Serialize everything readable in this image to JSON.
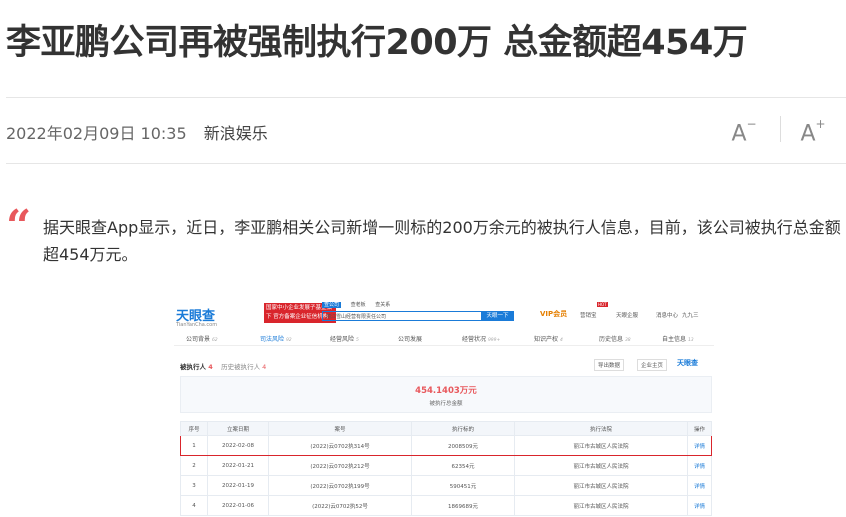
{
  "article": {
    "title": "李亚鹏公司再被强制执行200万 总金额超454万",
    "date": "2022年02月09日 10:35",
    "source": "新浪娱乐",
    "font_decrease": "A",
    "font_increase": "A",
    "quote_mark": "“",
    "quote": "据天眼查App显示，近日，李亚鹏相关公司新增一则标的200万余元的被执行人信息，目前，该公司被执行总金额超454万元。"
  },
  "screenshot": {
    "logo": "天眼查",
    "logo_sub": "TianYanCha.com",
    "banner": "国家中小企业发展子基金旗下 官方备案企业征信机构",
    "search_tabs": [
      "查公司",
      "查老板",
      "查关系"
    ],
    "search_value": "丽江雪山经营有限责任公司",
    "search_button": "天眼一下",
    "nav_vip": "VIP会员",
    "nav_items": [
      "营销宝",
      "天眼企服",
      "消息中心",
      "九九三"
    ],
    "tabs": [
      {
        "label": "公司背景",
        "count": "62"
      },
      {
        "label": "司法风险",
        "count": "92"
      },
      {
        "label": "经营风险",
        "count": "5"
      },
      {
        "label": "公司发展",
        "count": ""
      },
      {
        "label": "经营状况",
        "count": "999+"
      },
      {
        "label": "知识产权",
        "count": "4"
      },
      {
        "label": "历史信息",
        "count": "38"
      },
      {
        "label": "自主信息",
        "count": "13"
      }
    ],
    "section_title": "被执行人",
    "section_count": "4",
    "history_label": "历史被执行人",
    "history_count": "4",
    "export_label": "导出数据",
    "monitor_label": "企业主页",
    "brand2": "天眼查",
    "summary_amount": "454.1403万元",
    "summary_label": "被执行总金额",
    "table": {
      "headers": [
        "序号",
        "立案日期",
        "案号",
        "执行标的",
        "执行法院",
        "操作"
      ],
      "rows": [
        [
          "1",
          "2022-02-08",
          "(2022)云0702执314号",
          "2008509元",
          "丽江市古城区人民法院",
          "详情"
        ],
        [
          "2",
          "2022-01-21",
          "(2022)云0702执212号",
          "62354元",
          "丽江市古城区人民法院",
          "详情"
        ],
        [
          "3",
          "2022-01-19",
          "(2022)云0702执199号",
          "590451元",
          "丽江市古城区人民法院",
          "详情"
        ],
        [
          "4",
          "2022-01-06",
          "(2022)云0702执52号",
          "1869689元",
          "丽江市古城区人民法院",
          "详情"
        ]
      ]
    },
    "hot": "HOT"
  }
}
